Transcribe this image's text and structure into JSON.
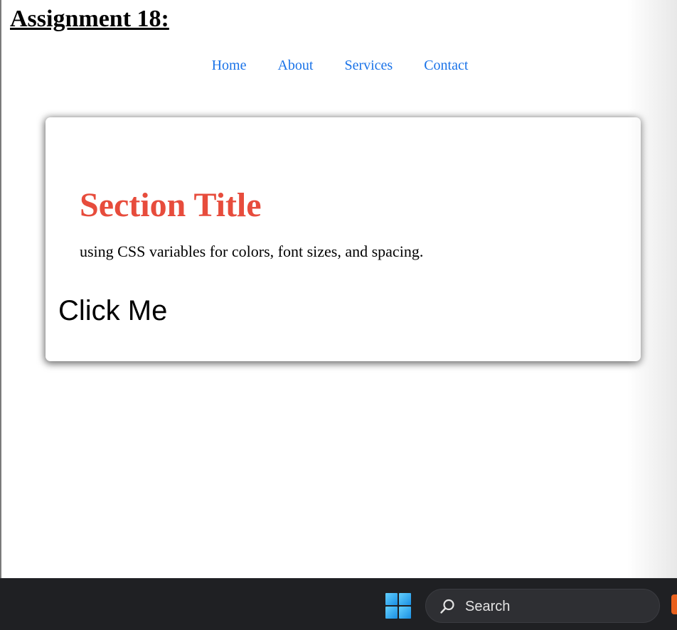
{
  "page": {
    "heading": "Assignment 18:"
  },
  "nav": {
    "items": [
      {
        "label": "Home"
      },
      {
        "label": "About"
      },
      {
        "label": "Services"
      },
      {
        "label": "Contact"
      }
    ],
    "link_color": "#1a73e8"
  },
  "card": {
    "title": "Section Title",
    "description": "using CSS variables for colors, font sizes, and spacing.",
    "button_label": "Click Me",
    "title_color": "#e74c3c"
  },
  "taskbar": {
    "start_icon": "windows-start-icon",
    "search_icon": "search-icon",
    "search_label": "Search",
    "tray_icon": "brave-browser-icon"
  }
}
